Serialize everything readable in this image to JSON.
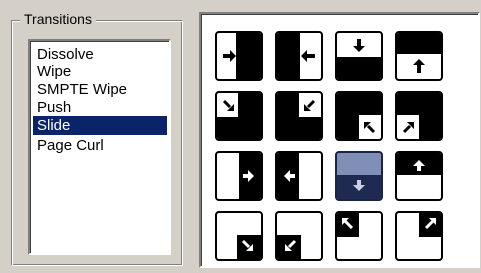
{
  "group": {
    "title": "Transitions"
  },
  "transitions": {
    "items": [
      "Dissolve",
      "Wipe",
      "SMPTE Wipe",
      "Push",
      "Slide",
      "Page Curl"
    ],
    "selected": "Slide"
  },
  "styles": {
    "selection_color": "#0a246a",
    "selected_tile_color": "#7f8fb6",
    "panel_background": "#d4d0c8"
  },
  "slide_directions": [
    {
      "name": "from-left-right-arrow-icon",
      "selected": false
    },
    {
      "name": "from-right-left-arrow-icon",
      "selected": false
    },
    {
      "name": "from-top-down-arrow-icon",
      "selected": false
    },
    {
      "name": "from-bottom-up-arrow-icon",
      "selected": false
    },
    {
      "name": "from-top-left-diagonal-icon",
      "selected": false
    },
    {
      "name": "from-top-right-diagonal-icon",
      "selected": false
    },
    {
      "name": "from-bottom-right-diagonal-icon",
      "selected": false
    },
    {
      "name": "from-bottom-left-diagonal-icon",
      "selected": false
    },
    {
      "name": "out-right-arrow-icon",
      "selected": false
    },
    {
      "name": "out-left-arrow-icon",
      "selected": false
    },
    {
      "name": "out-down-arrow-icon",
      "selected": true
    },
    {
      "name": "out-up-arrow-icon",
      "selected": false
    },
    {
      "name": "out-bottom-right-diagonal-icon",
      "selected": false
    },
    {
      "name": "out-bottom-left-diagonal-icon",
      "selected": false
    },
    {
      "name": "out-top-left-diagonal-icon",
      "selected": false
    },
    {
      "name": "out-top-right-diagonal-icon",
      "selected": false
    }
  ]
}
